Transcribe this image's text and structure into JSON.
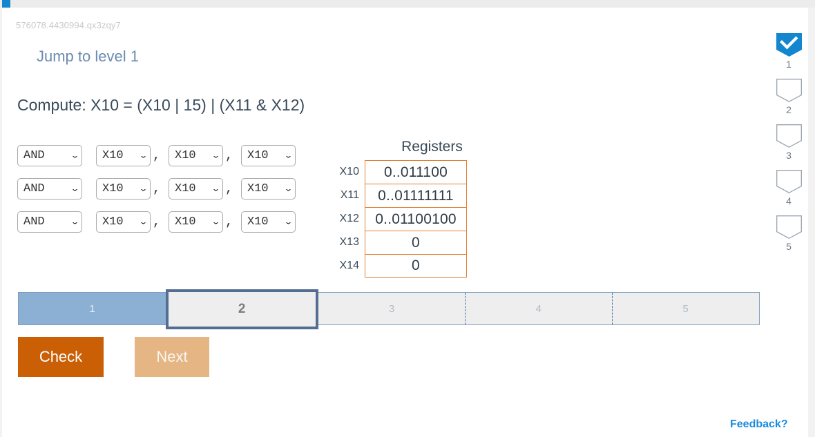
{
  "window": {
    "activity_id": "576078.4430994.qx3zqy7"
  },
  "header": {
    "jump_link": "Jump to level 1",
    "prompt": "Compute: X10 = (X10 | 15) | (X11 & X12)"
  },
  "instructions": {
    "rows": [
      {
        "op": "AND",
        "rd": "X10",
        "rs1": "X10",
        "rs2": "X10"
      },
      {
        "op": "AND",
        "rd": "X10",
        "rs1": "X10",
        "rs2": "X10"
      },
      {
        "op": "AND",
        "rd": "X10",
        "rs1": "X10",
        "rs2": "X10"
      }
    ],
    "comma": ",",
    "caret": "⌄"
  },
  "registers": {
    "title": "Registers",
    "rows": [
      {
        "name": "X10",
        "value": "0..011100"
      },
      {
        "name": "X11",
        "value": "0..01111111"
      },
      {
        "name": "X12",
        "value": "0..01100100"
      },
      {
        "name": "X13",
        "value": "0"
      },
      {
        "name": "X14",
        "value": "0"
      }
    ],
    "border_color": "#e08033"
  },
  "stepbar": {
    "steps": [
      {
        "label": "1",
        "state": "done"
      },
      {
        "label": "2",
        "state": "current"
      },
      {
        "label": "3",
        "state": "pending"
      },
      {
        "label": "4",
        "state": "pending"
      },
      {
        "label": "5",
        "state": "pending"
      }
    ],
    "done_color": "#8cb0d4",
    "current_border_color": "#546e93"
  },
  "buttons": {
    "check": "Check",
    "next": "Next",
    "check_color": "#ca5f05",
    "next_color": "#e6b584"
  },
  "footer": {
    "feedback": "Feedback?",
    "feedback_color": "#1a8cdb"
  },
  "levels": {
    "items": [
      {
        "num": "1",
        "checked": true
      },
      {
        "num": "2",
        "checked": false
      },
      {
        "num": "3",
        "checked": false
      },
      {
        "num": "4",
        "checked": false
      },
      {
        "num": "5",
        "checked": false
      }
    ],
    "checked_color": "#1287d0"
  }
}
